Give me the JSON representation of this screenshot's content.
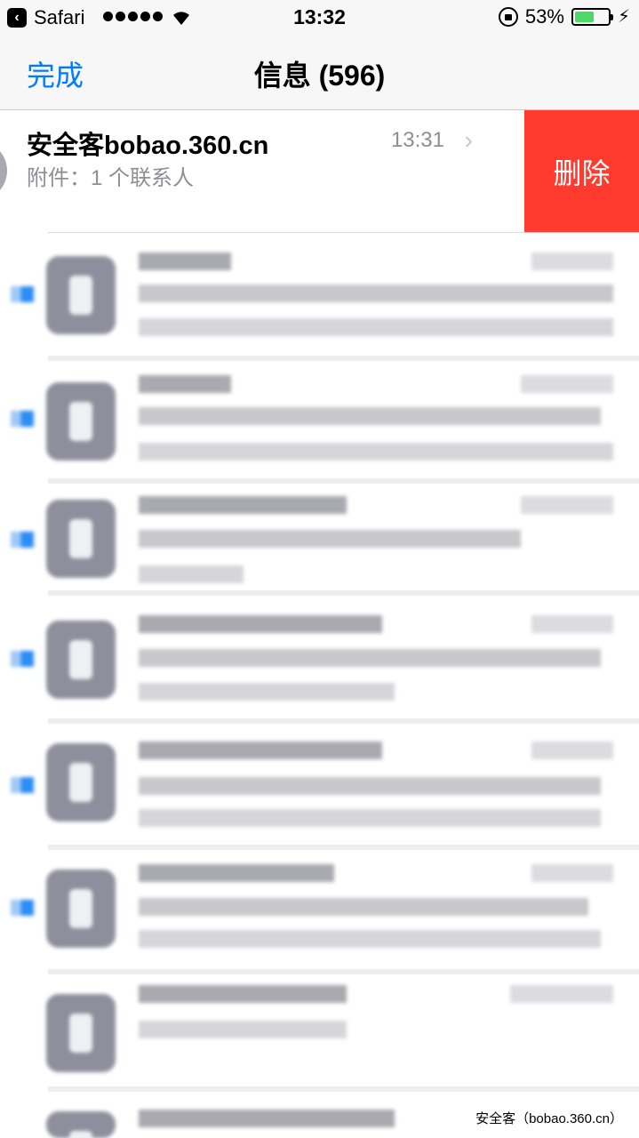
{
  "status_bar": {
    "back_app_label": "Safari",
    "time": "13:32",
    "battery_percent": "53%",
    "battery_level": 0.53
  },
  "nav": {
    "done_label": "完成",
    "title": "信息 (596)"
  },
  "first_thread": {
    "sender": "安全客bobao.360.cn",
    "preview": "附件：1 个联系人",
    "time": "13:31",
    "delete_label": "删除"
  },
  "watermark": "安全客（bobao.360.cn）",
  "colors": {
    "accent": "#007aff",
    "delete": "#ff3b30",
    "battery": "#4cd964",
    "unread": "#2c8df5"
  },
  "icons": {
    "back_app": "back-arrow-icon",
    "wifi": "wifi-icon",
    "rotation_lock": "rotation-lock-icon",
    "battery": "battery-icon",
    "charging": "charging-bolt-icon",
    "chevron": "chevron-right-icon"
  }
}
